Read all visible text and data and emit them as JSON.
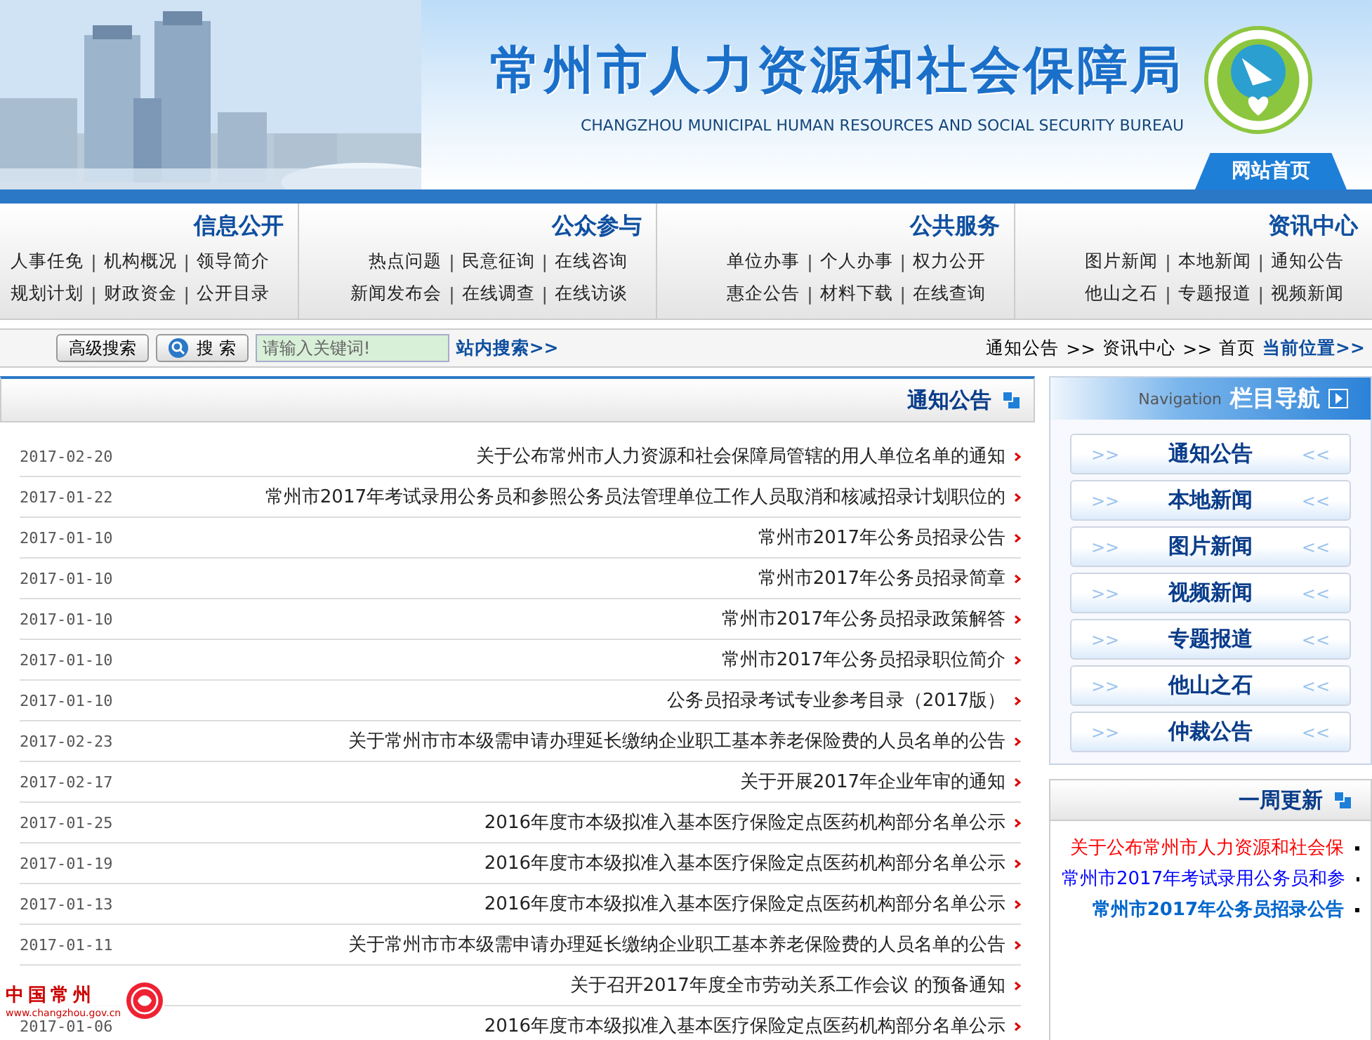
{
  "header": {
    "title": "常州市人力资源和社会保障局",
    "subtitle": "CHANGZHOU MUNICIPAL HUMAN RESOURCES AND SOCIAL SECURITY BUREAU",
    "home_tab": "网站首页"
  },
  "nav": {
    "separator": "|",
    "sections": [
      {
        "title": "信息公开",
        "rows": [
          [
            "人事任免",
            "机构概况",
            "领导简介"
          ],
          [
            "规划计划",
            "财政资金",
            "公开目录"
          ]
        ]
      },
      {
        "title": "公众参与",
        "rows": [
          [
            "热点问题",
            "民意征询",
            "在线咨询"
          ],
          [
            "新闻发布会",
            "在线调查",
            "在线访谈"
          ]
        ]
      },
      {
        "title": "公共服务",
        "rows": [
          [
            "单位办事",
            "个人办事",
            "权力公开"
          ],
          [
            "惠企公告",
            "材料下载",
            "在线查询"
          ]
        ]
      },
      {
        "title": "资讯中心",
        "rows": [
          [
            "图片新闻",
            "本地新闻",
            "通知公告"
          ],
          [
            "他山之石",
            "专题报道",
            "视频新闻"
          ]
        ]
      }
    ]
  },
  "breadcrumb": {
    "label": "当前位置>>",
    "items": [
      "通知公告",
      "资讯中心",
      "首页"
    ],
    "separator": ">>"
  },
  "search": {
    "label": "站内搜索>>",
    "placeholder": "请输入关键词!",
    "button": "搜 索",
    "advanced": "高级搜索"
  },
  "sidebar": {
    "title": "栏目导航",
    "subtitle": "Navigation",
    "arrows": "<<",
    "end_arrows": ">>",
    "items": [
      "通知公告",
      "本地新闻",
      "图片新闻",
      "视频新闻",
      "专题报道",
      "他山之石",
      "仲裁公告"
    ]
  },
  "weekly": {
    "title": "一周更新",
    "items": [
      {
        "text": "关于公布常州市人力资源和社会保",
        "color": "#ff0000",
        "bold": false
      },
      {
        "text": "常州市2017年考试录用公务员和参",
        "color": "#0000ff",
        "bold": false
      },
      {
        "text": "常州市2017年公务员招录公告",
        "color": "#0066cc",
        "bold": true
      }
    ]
  },
  "main": {
    "title": "通知公告",
    "rows": [
      {
        "title": "关于公布常州市人力资源和社会保障局管辖的用人单位名单的通知",
        "date": "2017-02-20"
      },
      {
        "title": "常州市2017年考试录用公务员和参照公务员法管理单位工作人员取消和核减招录计划职位的",
        "date": "2017-01-22"
      },
      {
        "title": "常州市2017年公务员招录公告",
        "date": "2017-01-10"
      },
      {
        "title": "常州市2017年公务员招录简章",
        "date": "2017-01-10"
      },
      {
        "title": "常州市2017年公务员招录政策解答",
        "date": "2017-01-10"
      },
      {
        "title": "常州市2017年公务员招录职位简介",
        "date": "2017-01-10"
      },
      {
        "title": "公务员招录考试专业参考目录（2017版）",
        "date": "2017-01-10"
      },
      {
        "title": "关于常州市市本级需申请办理延长缴纳企业职工基本养老保险费的人员名单的公告",
        "date": "2017-02-23"
      },
      {
        "title": "关于开展2017年企业年审的通知",
        "date": "2017-02-17"
      },
      {
        "title": "2016年度市本级拟准入基本医疗保险定点医药机构部分名单公示",
        "date": "2017-01-25"
      },
      {
        "title": "2016年度市本级拟准入基本医疗保险定点医药机构部分名单公示",
        "date": "2017-01-19"
      },
      {
        "title": "2016年度市本级拟准入基本医疗保险定点医药机构部分名单公示",
        "date": "2017-01-13"
      },
      {
        "title": "关于常州市市本级需申请办理延长缴纳企业职工基本养老保险费的人员名单的公告",
        "date": "2017-01-11"
      },
      {
        "title": "关于召开2017年度全市劳动关系工作会议 的预备通知"
      },
      {
        "title": "2016年度市本级拟准入基本医疗保险定点医药机构部分名单公示",
        "date": "2017-01-06"
      }
    ]
  },
  "badge": {
    "title": "中国常州",
    "url": "www.changzhou.gov.cn"
  }
}
